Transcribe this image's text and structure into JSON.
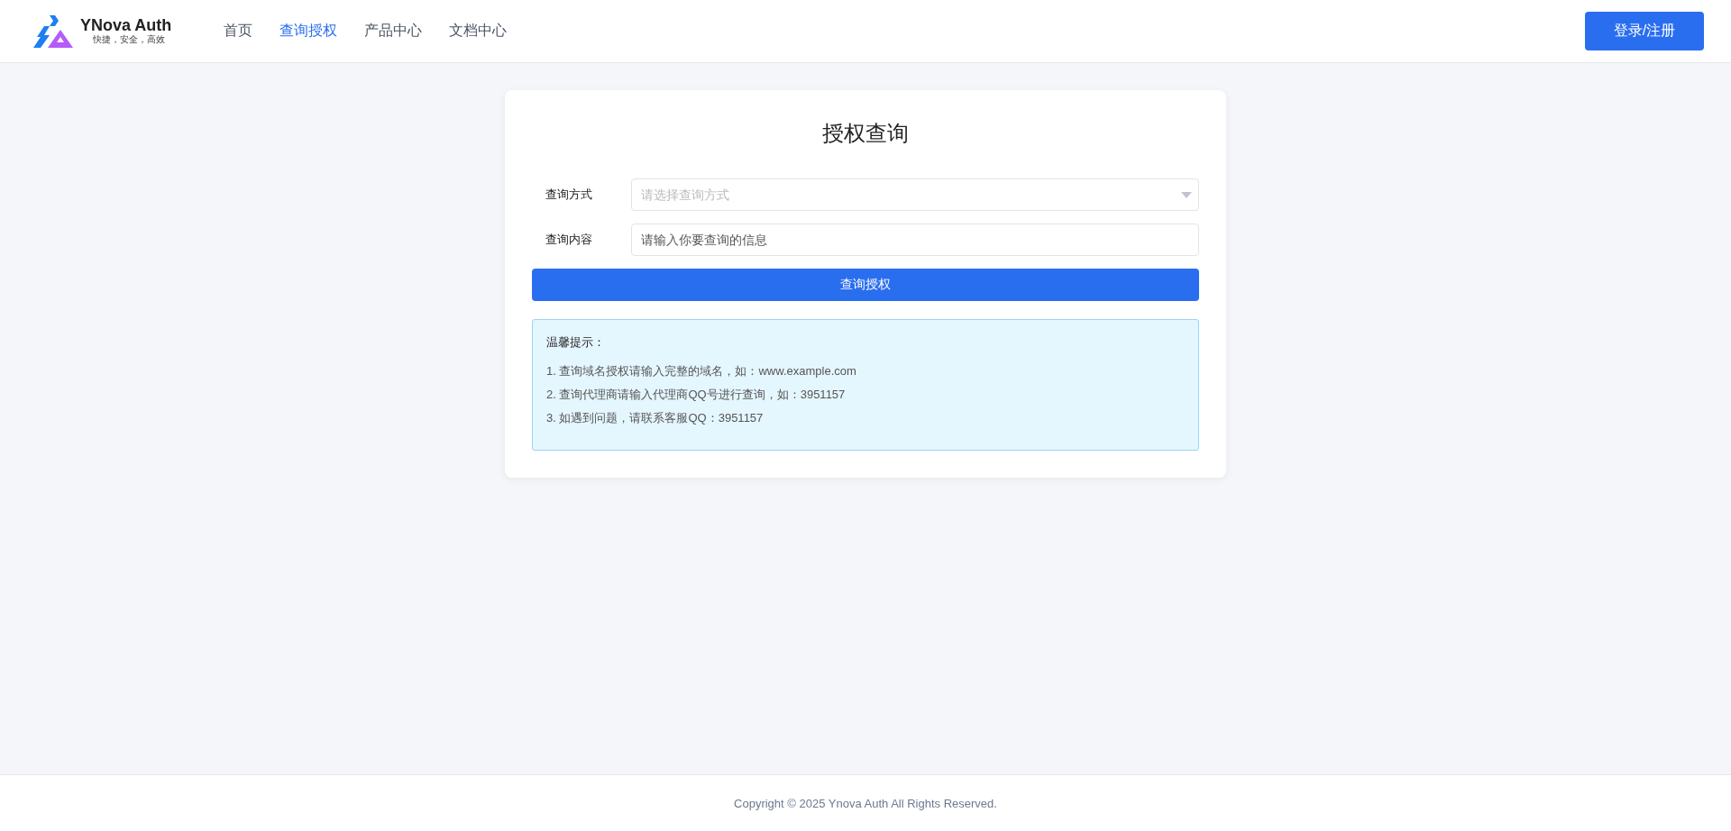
{
  "header": {
    "logo": {
      "title": "YNova Auth",
      "slogan": "快捷，安全，高效"
    },
    "nav": [
      {
        "label": "首页",
        "selected": false
      },
      {
        "label": "查询授权",
        "selected": true
      },
      {
        "label": "产品中心",
        "selected": false
      },
      {
        "label": "文档中心",
        "selected": false
      }
    ],
    "login_button": "登录/注册"
  },
  "card": {
    "title": "授权查询",
    "fields": [
      {
        "kind": "select",
        "label": "查询方式",
        "placeholder": "请选择查询方式"
      },
      {
        "kind": "input",
        "label": "查询内容",
        "placeholder": "请输入你要查询的信息"
      }
    ],
    "submit_button": "查询授权",
    "tips": {
      "title": "温馨提示：",
      "items": [
        "1. 查询域名授权请输入完整的域名，如：www.example.com",
        "2. 查询代理商请输入代理商QQ号进行查询，如：3951157",
        "3. 如遇到问题，请联系客服QQ：3951157"
      ]
    }
  },
  "footer": {
    "copyright": "Copyright © 2025 Ynova Auth All Rights Reserved."
  }
}
